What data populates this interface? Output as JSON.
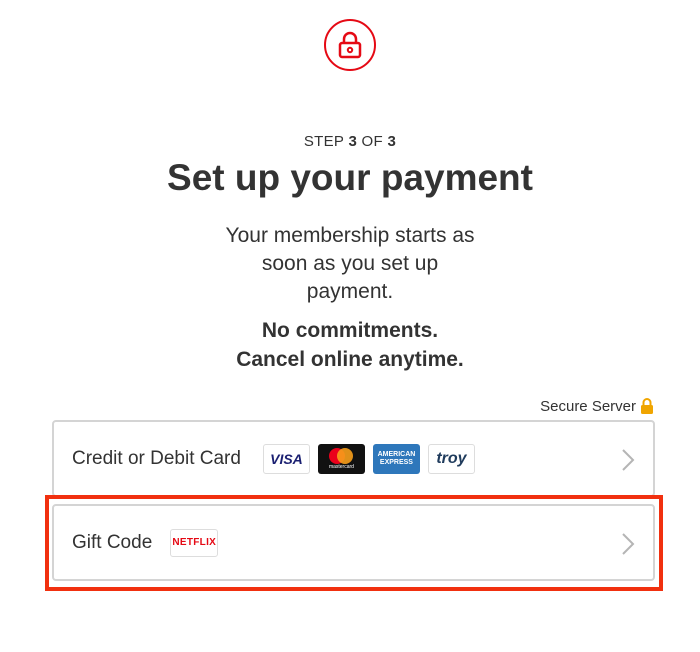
{
  "header": {
    "step_prefix": "STEP ",
    "step_current": "3",
    "step_of": " OF ",
    "step_total": "3",
    "title": "Set up your payment",
    "description": "Your membership starts as soon as you set up payment.",
    "commit_line1": "No commitments.",
    "commit_line2": "Cancel online anytime."
  },
  "secure": {
    "label": "Secure Server",
    "icon": "padlock-icon",
    "icon_color": "#f0a500"
  },
  "options": [
    {
      "label": "Credit or Debit Card",
      "logos": [
        "VISA",
        "mastercard",
        "AMERICAN EXPRESS",
        "troy"
      ]
    },
    {
      "label": "Gift Code",
      "logos": [
        "NETFLIX"
      ]
    }
  ],
  "colors": {
    "brand": "#e50914",
    "highlight": "#f1300f",
    "text": "#333333",
    "border": "#d4d4d4"
  }
}
